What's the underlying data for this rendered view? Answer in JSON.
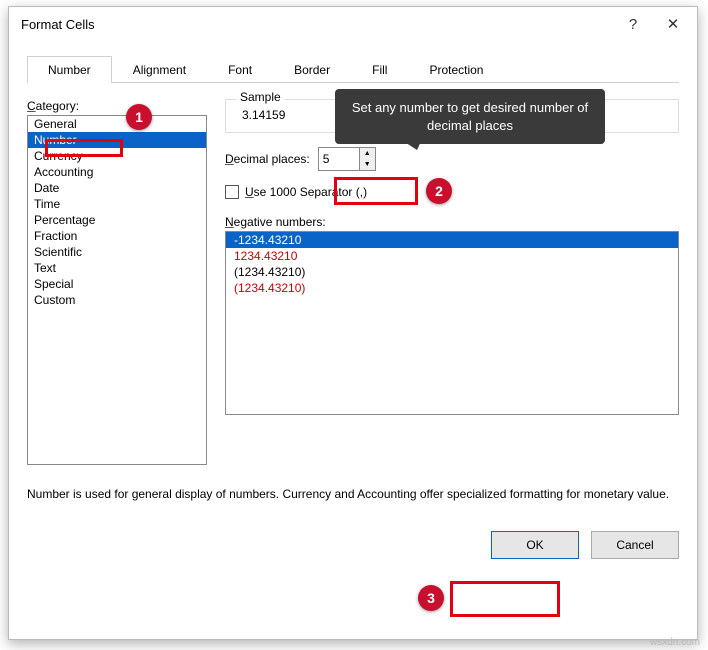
{
  "dialog": {
    "title": "Format Cells"
  },
  "titlebar": {
    "help": "?",
    "close": "✕"
  },
  "tabs": [
    "Number",
    "Alignment",
    "Font",
    "Border",
    "Fill",
    "Protection"
  ],
  "leftpanel": {
    "label": "Category:",
    "items": [
      "General",
      "Number",
      "Currency",
      "Accounting",
      "Date",
      "Time",
      "Percentage",
      "Fraction",
      "Scientific",
      "Text",
      "Special",
      "Custom"
    ],
    "selected_index": 1
  },
  "sample": {
    "legend": "Sample",
    "value": "3.14159"
  },
  "decimal": {
    "label": "Decimal places:",
    "value": "5"
  },
  "separator": {
    "label": "Use 1000 Separator (,)"
  },
  "negative": {
    "label": "Negative numbers:",
    "items": [
      {
        "text": "-1234.43210",
        "class": "sel"
      },
      {
        "text": "1234.43210",
        "class": "red"
      },
      {
        "text": "(1234.43210)",
        "class": ""
      },
      {
        "text": "(1234.43210)",
        "class": "red"
      }
    ]
  },
  "description": "Number is used for general display of numbers.  Currency and Accounting offer specialized formatting for monetary value.",
  "buttons": {
    "ok": "OK",
    "cancel": "Cancel"
  },
  "annotations": {
    "tooltip": "Set any number to get desired number of decimal places",
    "marks": [
      "1",
      "2",
      "3"
    ]
  },
  "watermark": "wsxdn.com"
}
